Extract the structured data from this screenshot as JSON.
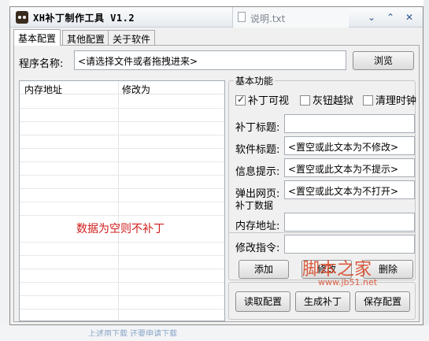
{
  "window": {
    "title": "XH补丁制作工具 V1.2",
    "doc_tab_label": "说明.txt",
    "controls": {
      "chevron_down": "⌄",
      "chevron_up": "⌃",
      "close": "✕"
    }
  },
  "tabs": [
    {
      "label": "基本配置",
      "active": true
    },
    {
      "label": "其他配置",
      "active": false
    },
    {
      "label": "关于软件",
      "active": false
    }
  ],
  "program": {
    "label": "程序名称:",
    "value": "<请选择文件或者拖拽进来>",
    "browse_button": "浏览"
  },
  "list": {
    "columns": [
      "内存地址",
      "修改为"
    ],
    "empty_note": "数据为空则不补丁"
  },
  "basic": {
    "group_title": "基本功能",
    "checkboxes": [
      {
        "label": "补丁可视",
        "checked": true
      },
      {
        "label": "灰钮越狱",
        "checked": false
      },
      {
        "label": "清理时钟",
        "checked": false
      }
    ],
    "fields": [
      {
        "label": "补丁标题:",
        "value": ""
      },
      {
        "label": "软件标题:",
        "value": "<置空或此文本为不修改>"
      },
      {
        "label": "信息提示:",
        "value": "<置空或此文本为不提示>"
      },
      {
        "label": "弹出网页:",
        "value": "<置空或此文本为不打开>"
      }
    ]
  },
  "patch": {
    "group_title": "补丁数据",
    "address_label": "内存地址:",
    "address_value": "",
    "command_label": "修改指令:",
    "command_value": "",
    "buttons": {
      "add": "添加",
      "modify": "修改",
      "delete": "删除"
    }
  },
  "bottom_buttons": {
    "load": "读取配置",
    "generate": "生成补丁",
    "save": "保存配置"
  },
  "watermark": {
    "text": "脚本之家",
    "url": "www.jb51.net"
  },
  "background": {
    "strip": "上述用下载    还要申请下载"
  },
  "colors": {
    "empty_note": "#d11c1c",
    "watermark": "#d94a2a",
    "title_controls": "#2d5a8a"
  }
}
